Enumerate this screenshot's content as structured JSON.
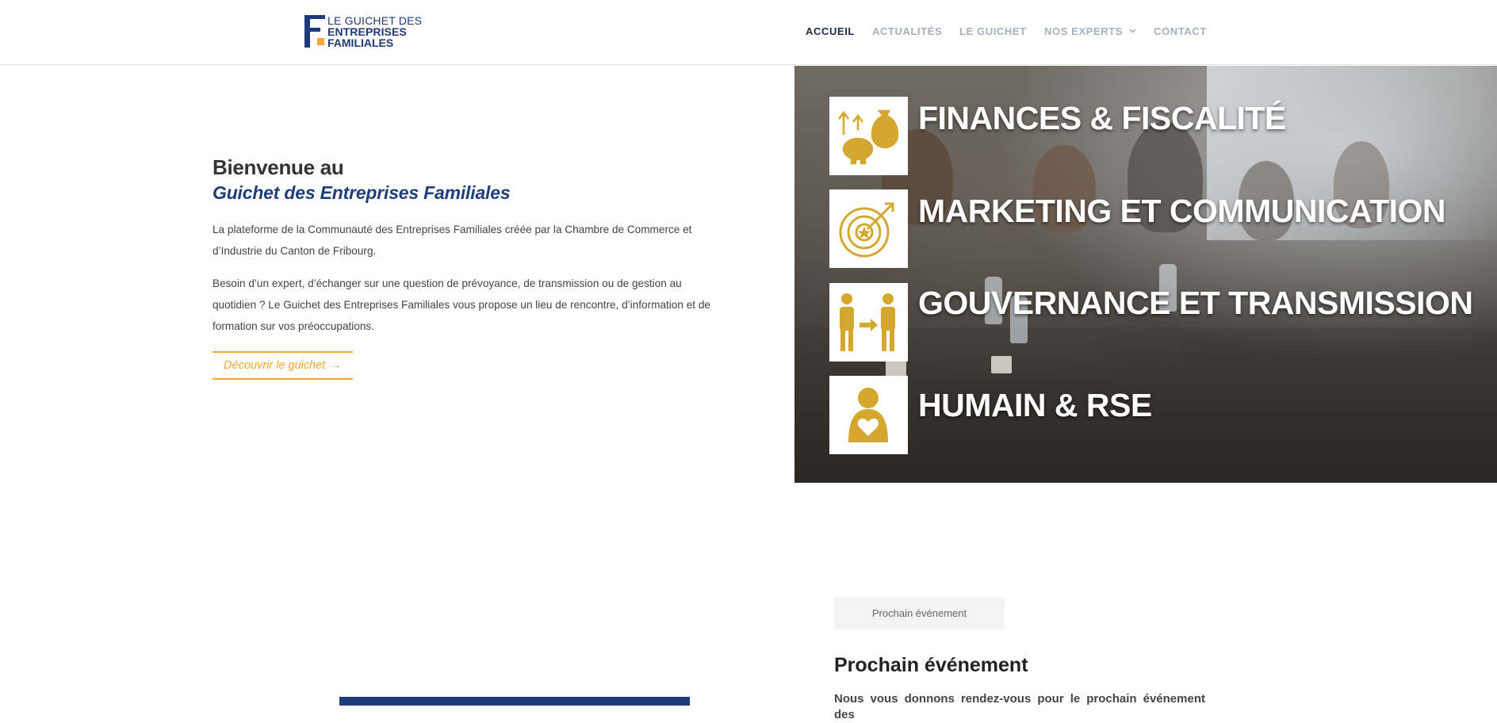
{
  "header": {
    "logo": {
      "line1": "LE GUICHET DES",
      "line2": "ENTREPRISES",
      "line3": "FAMILIALES",
      "brand_blue": "#1e3a78",
      "accent": "#f0a830"
    },
    "nav": [
      {
        "label": "ACCUEIL",
        "active": true
      },
      {
        "label": "ACTUALITÉS",
        "active": false
      },
      {
        "label": "LE GUICHET",
        "active": false
      },
      {
        "label": "NOS EXPERTS",
        "active": false,
        "has_dropdown": true
      },
      {
        "label": "CONTACT",
        "active": false
      }
    ]
  },
  "intro": {
    "heading": "Bienvenue au",
    "subheading": "Guichet des Entreprises Familiales",
    "paragraph1": "La plateforme de la Communauté des Entreprises Familiales créée par la Chambre de Commerce et d’Industrie du Canton de Fribourg.",
    "paragraph2": "Besoin d’un expert, d’échanger sur une question de prévoyance, de transmission ou de gestion au quotidien ? Le Guichet des Entreprises Familiales vous propose un lieu de rencontre, d’information et de formation sur vos préoccupations.",
    "cta_label": "Découvrir le guichet",
    "cta_arrow": "→"
  },
  "categories": [
    {
      "label": "FINANCES & FISCALITÉ",
      "icon": "finance-icon"
    },
    {
      "label": "MARKETING ET COMMUNICATION",
      "icon": "target-icon"
    },
    {
      "label": "GOUVERNANCE ET TRANSMISSION",
      "icon": "transmission-icon"
    },
    {
      "label": "HUMAIN & RSE",
      "icon": "human-heart-icon"
    }
  ],
  "icon_color": "#d4a82f",
  "event": {
    "tab_label": "Prochain événement",
    "title": "Prochain événement",
    "text": "Nous vous donnons rendez-vous pour le prochain événement des"
  }
}
